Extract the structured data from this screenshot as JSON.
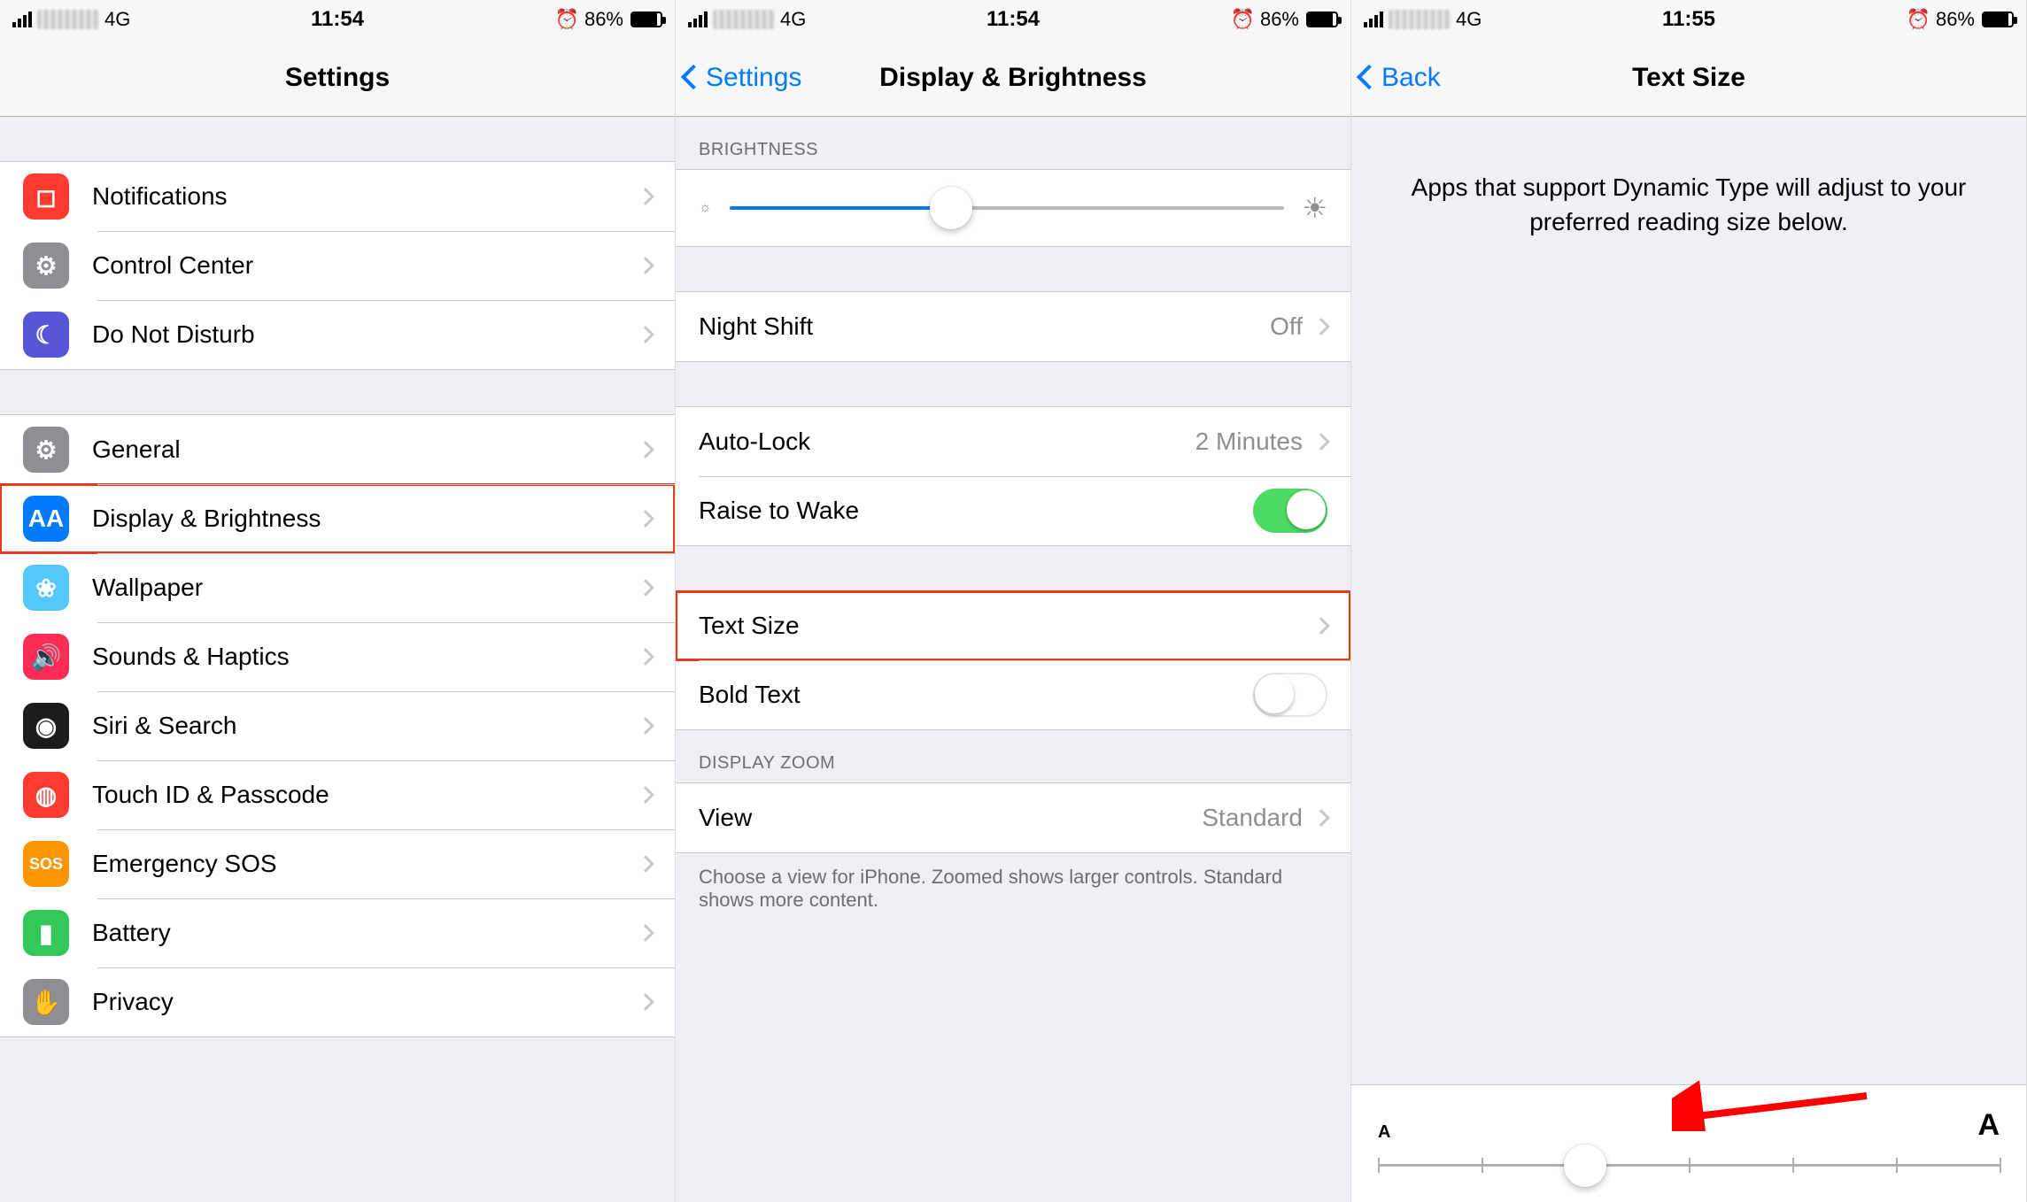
{
  "status": {
    "network": "4G",
    "time1": "11:54",
    "time2": "11:54",
    "time3": "11:55",
    "battery_pct": "86%",
    "alarm": "⏰"
  },
  "screen1": {
    "title": "Settings",
    "groups": [
      {
        "items": [
          {
            "icon": "notifications-icon",
            "color": "ic-red",
            "glyph": "◻",
            "label": "Notifications"
          },
          {
            "icon": "control-center-icon",
            "color": "ic-gray",
            "glyph": "⚙",
            "label": "Control Center"
          },
          {
            "icon": "dnd-icon",
            "color": "ic-purple",
            "glyph": "☾",
            "label": "Do Not Disturb"
          }
        ]
      },
      {
        "items": [
          {
            "icon": "general-icon",
            "color": "ic-gray2",
            "glyph": "⚙",
            "label": "General"
          },
          {
            "icon": "display-icon",
            "color": "ic-blue",
            "glyph": "AA",
            "label": "Display & Brightness",
            "hl": true
          },
          {
            "icon": "wallpaper-icon",
            "color": "ic-cyan",
            "glyph": "❀",
            "label": "Wallpaper"
          },
          {
            "icon": "sounds-icon",
            "color": "ic-pink",
            "glyph": "🔊",
            "label": "Sounds & Haptics"
          },
          {
            "icon": "siri-icon",
            "color": "ic-black",
            "glyph": "◉",
            "label": "Siri & Search"
          },
          {
            "icon": "touchid-icon",
            "color": "ic-red2",
            "glyph": "◍",
            "label": "Touch ID & Passcode"
          },
          {
            "icon": "sos-icon",
            "color": "ic-orange",
            "glyph": "SOS",
            "label": "Emergency SOS"
          },
          {
            "icon": "battery-icon",
            "color": "ic-green",
            "glyph": "▮",
            "label": "Battery"
          },
          {
            "icon": "privacy-icon",
            "color": "ic-gray",
            "glyph": "✋",
            "label": "Privacy"
          }
        ]
      }
    ]
  },
  "screen2": {
    "back": "Settings",
    "title": "Display & Brightness",
    "brightness_header": "BRIGHTNESS",
    "brightness_value_pct": 40,
    "night_shift": {
      "label": "Night Shift",
      "value": "Off"
    },
    "auto_lock": {
      "label": "Auto-Lock",
      "value": "2 Minutes"
    },
    "raise_to_wake": {
      "label": "Raise to Wake",
      "on": true
    },
    "text_size": {
      "label": "Text Size",
      "hl": true
    },
    "bold_text": {
      "label": "Bold Text",
      "on": false
    },
    "zoom_header": "DISPLAY ZOOM",
    "view": {
      "label": "View",
      "value": "Standard"
    },
    "footer": "Choose a view for iPhone. Zoomed shows larger controls. Standard shows more content."
  },
  "screen3": {
    "back": "Back",
    "title": "Text Size",
    "desc": "Apps that support Dynamic Type will adjust to your preferred reading size below.",
    "small_label": "A",
    "big_label": "A",
    "slider_step": 2,
    "slider_steps": 7
  }
}
